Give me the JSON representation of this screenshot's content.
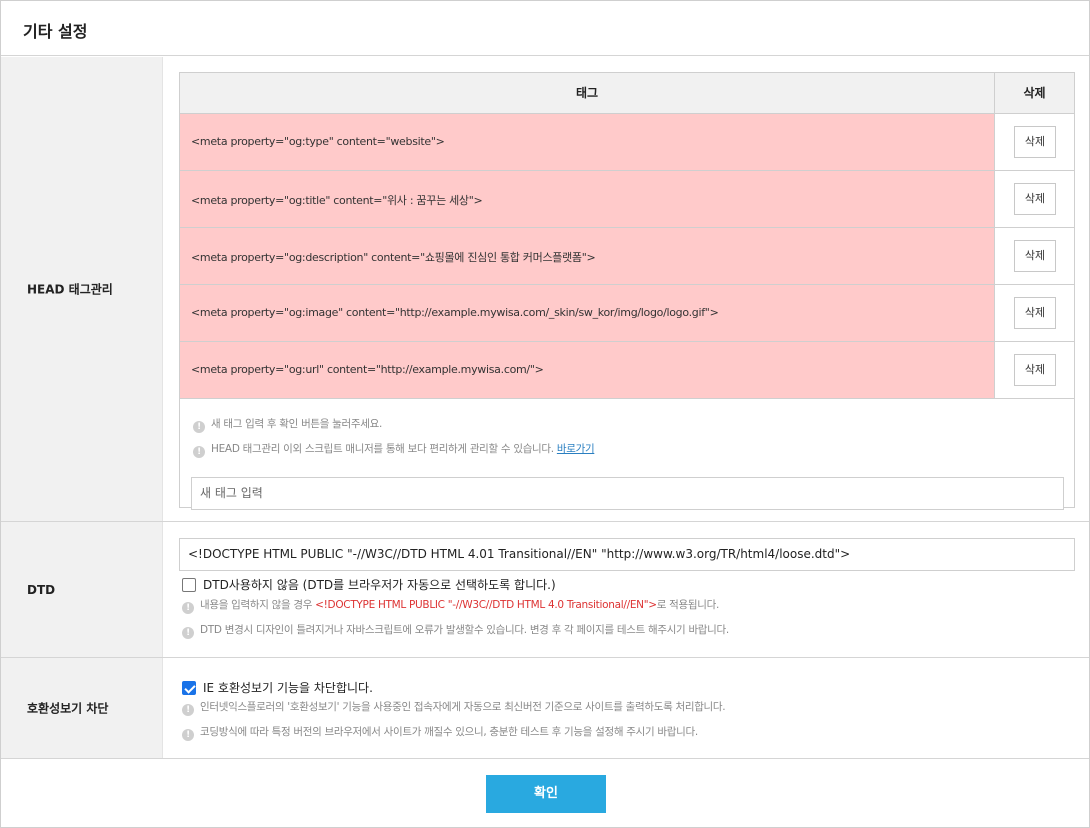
{
  "header": {
    "title": "기타 설정"
  },
  "head_section": {
    "label": "HEAD 태그관리",
    "columns": {
      "tag": "태그",
      "delete": "삭제"
    },
    "rows": [
      {
        "tag": "<meta property=\"og:type\" content=\"website\">",
        "delete_label": "삭제"
      },
      {
        "tag": "<meta property=\"og:title\" content=\"위사 : 꿈꾸는 세상\">",
        "delete_label": "삭제"
      },
      {
        "tag": "<meta property=\"og:description\" content=\"쇼핑몰에 진심인 통합 커머스플랫폼\">",
        "delete_label": "삭제"
      },
      {
        "tag": "<meta property=\"og:image\" content=\"http://example.mywisa.com/_skin/sw_kor/img/logo/logo.gif\">",
        "delete_label": "삭제"
      },
      {
        "tag": "<meta property=\"og:url\" content=\"http://example.mywisa.com/\">",
        "delete_label": "삭제"
      }
    ],
    "note1": "새 태그 입력 후 확인 버튼을 눌러주세요.",
    "note2": "HEAD 태그관리 이외 스크립트 매니저를 통해 보다 편리하게 관리할 수 있습니다.",
    "note2_link": "바로가기",
    "new_tag_placeholder": "새 태그 입력",
    "row_color": "#ffcaca"
  },
  "dtd_section": {
    "label": "DTD",
    "value": "<!DOCTYPE HTML PUBLIC \"-//W3C//DTD HTML 4.01 Transitional//EN\" \"http://www.w3.org/TR/html4/loose.dtd\">",
    "checkbox_label": "DTD사용하지 않음 (DTD를 브라우저가 자동으로 선택하도록 합니다.)",
    "checkbox_checked": false,
    "note1_prefix": "내용을 입력하지 않을 경우 ",
    "note1_code": "<!DOCTYPE HTML PUBLIC \"-//W3C//DTD HTML 4.0 Transitional//EN\">",
    "note1_suffix": "로 적용됩니다.",
    "note2": "DTD 변경시 디자인이 틀려지거나 자바스크립트에 오류가 발생할수 있습니다. 변경 후 각 페이지를 테스트 해주시기 바랍니다."
  },
  "ie_section": {
    "label": "호환성보기 차단",
    "checkbox_label": "IE 호환성보기 기능을 차단합니다.",
    "checkbox_checked": true,
    "note1": "인터넷익스플로러의 '호환성보기' 기능을 사용중인 접속자에게 자동으로 최신버전 기준으로 사이트를 출력하도록 처리합니다.",
    "note2": "코딩방식에 따라 특정 버전의 브라우저에서 사이트가 깨질수 있으니, 충분한 테스트 후 기능을 설정해 주시기 바랍니다."
  },
  "footer": {
    "confirm_label": "확인",
    "confirm_color": "#29a9e0"
  },
  "icons": {
    "notice": "notice-icon",
    "checkbox": "checkbox-icon"
  }
}
